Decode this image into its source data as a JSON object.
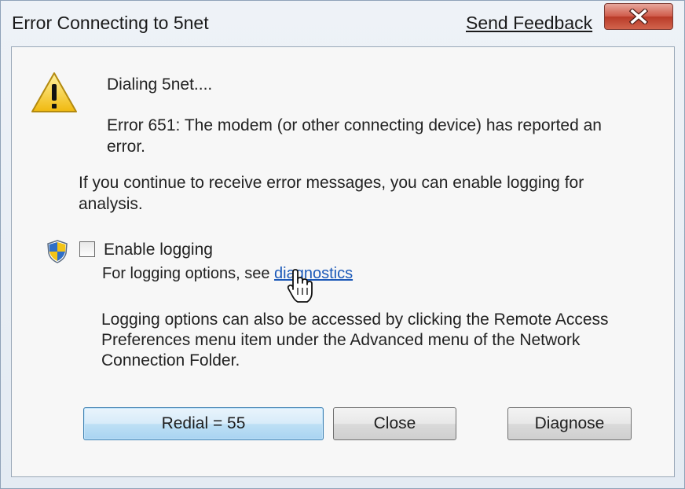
{
  "window": {
    "title": "Error Connecting to 5net",
    "feedback_link": "Send Feedback"
  },
  "message": {
    "dialing": "Dialing 5net....",
    "error_line1": "Error 651: The modem (or other connecting device) has reported an",
    "error_line2": "error.",
    "advice_line1": "If you continue to receive error messages, you can enable logging for",
    "advice_line2": "analysis."
  },
  "logging": {
    "checkbox_label": "Enable logging",
    "checked": false,
    "options_prefix": "For logging options, see ",
    "options_link": "diagnostics",
    "info_line1": "Logging options can also be accessed by clicking the Remote Access",
    "info_line2": "Preferences menu item under the Advanced menu of the Network",
    "info_line3": "Connection Folder."
  },
  "buttons": {
    "redial": "Redial = 55",
    "close": "Close",
    "diagnose": "Diagnose"
  },
  "icons": {
    "warning": "warning-triangle-icon",
    "shield": "uac-shield-icon",
    "cursor": "hand-pointer-icon",
    "close": "close-x-icon"
  }
}
